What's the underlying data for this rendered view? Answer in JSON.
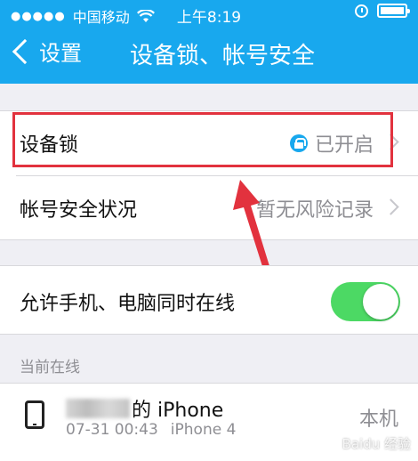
{
  "status_bar": {
    "carrier": "中国移动",
    "time": "上午8:19"
  },
  "nav": {
    "back_label": "设置",
    "title": "设备锁、帐号安全"
  },
  "security_group": {
    "items": [
      {
        "label": "设备锁",
        "value": "已开启"
      },
      {
        "label": "帐号安全状况",
        "value": "暂无风险记录"
      }
    ]
  },
  "online_setting": {
    "label": "允许手机、电脑同时在线",
    "enabled": true
  },
  "current_online": {
    "header": "当前在线",
    "device": {
      "name_suffix": "的 iPhone",
      "date": "07-31 00:43",
      "model": "iPhone 4",
      "tag": "本机"
    }
  },
  "watermark": "Baidu 经验",
  "colors": {
    "nav_blue": "#18a8ee",
    "highlight_red": "#e2323e",
    "toggle_green": "#4cd964"
  }
}
